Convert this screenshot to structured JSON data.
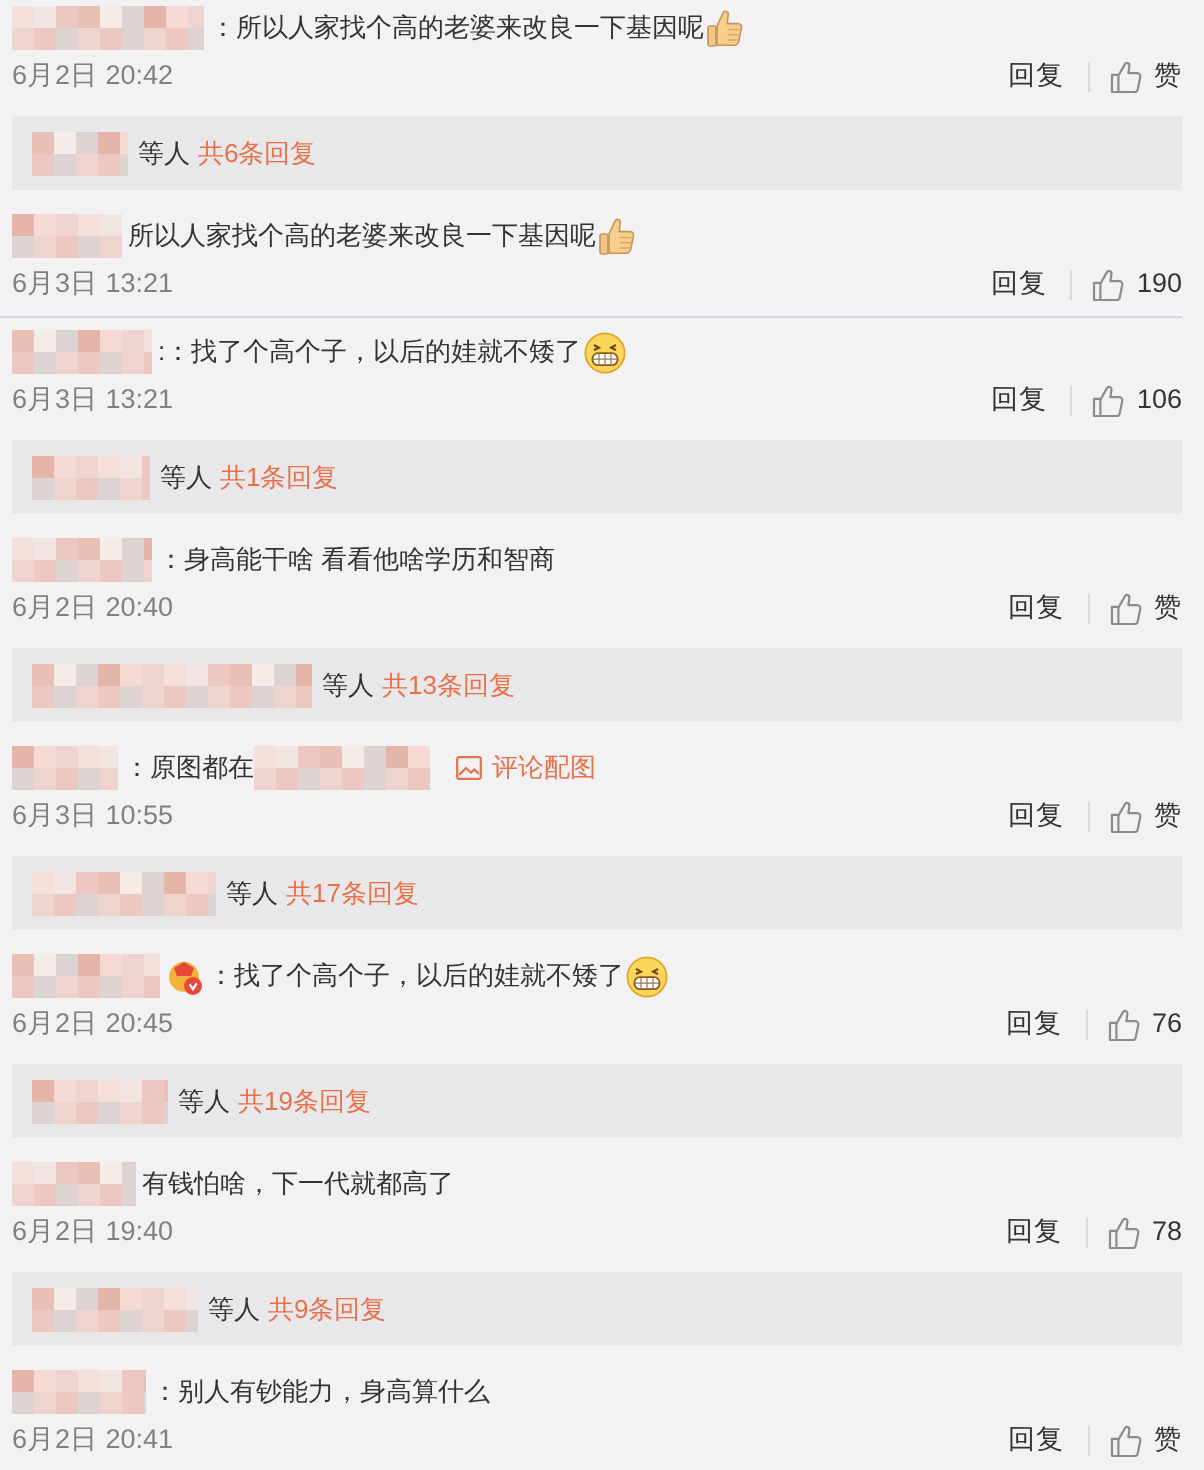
{
  "comments": [
    {
      "text": "：所以人家找个高的老婆来改良一下基因呢",
      "emoji": {
        "kind": "thumbs_up"
      },
      "date": "6月2日 20:42",
      "reply": "回复",
      "likes": "赞",
      "replies": {
        "who": "等人",
        "count": "共6条回复"
      }
    },
    {
      "text": "所以人家找个高的老婆来改良一下基因呢",
      "emoji": {
        "kind": "thumbs_up"
      },
      "date": "6月3日 13:21",
      "reply": "回复",
      "likes": "190"
    },
    {
      "text": ":：找了个高个子，以后的娃就不矮了",
      "emoji": {
        "kind": "grin"
      },
      "date": "6月3日 13:21",
      "reply": "回复",
      "likes": "106",
      "replies": {
        "who": "等人",
        "count": "共1条回复"
      }
    },
    {
      "text": "：身高能干啥 看看他啥学历和智商",
      "date": "6月2日 20:40",
      "reply": "回复",
      "likes": "赞",
      "replies": {
        "who": "等人",
        "count": "共13条回复"
      }
    },
    {
      "text": "：原图都在",
      "hidden_link": true,
      "image_link": "评论配图",
      "date": "6月3日 10:55",
      "reply": "回复",
      "likes": "赞",
      "replies": {
        "who": "等人",
        "count": "共17条回复"
      }
    },
    {
      "badge": true,
      "text": "：找了个高个子，以后的娃就不矮了",
      "emoji": {
        "kind": "grin"
      },
      "date": "6月2日 20:45",
      "reply": "回复",
      "likes": "76",
      "replies": {
        "who": "等人",
        "count": "共19条回复"
      }
    },
    {
      "text": "有钱怕啥，下一代就都高了",
      "date": "6月2日 19:40",
      "reply": "回复",
      "likes": "78",
      "replies": {
        "who": "等人",
        "count": "共9条回复"
      }
    },
    {
      "text": "：别人有钞能力，身高算什么",
      "date": "6月2日 20:41",
      "reply": "回复",
      "likes": "赞"
    }
  ]
}
